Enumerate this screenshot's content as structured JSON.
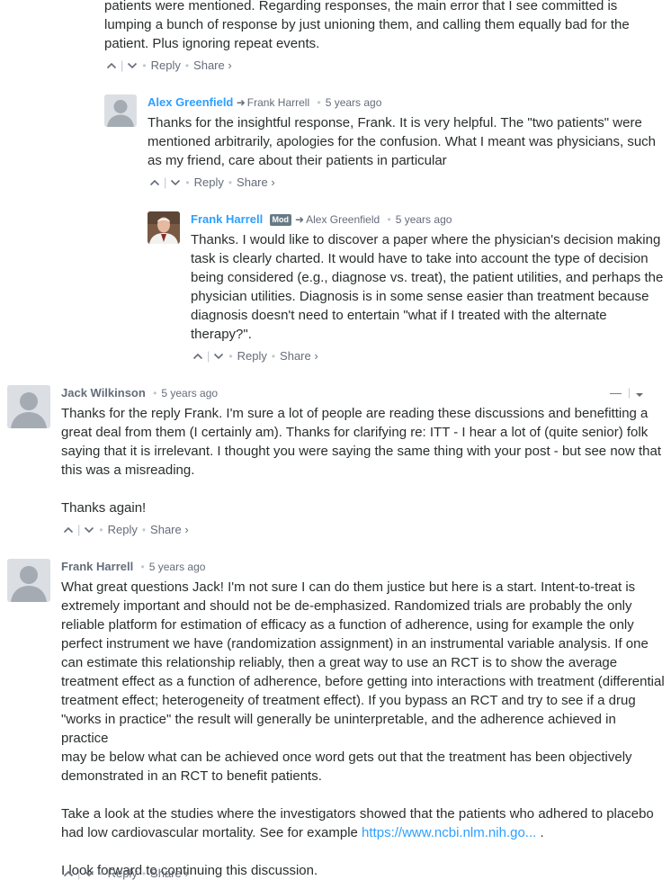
{
  "labels": {
    "reply": "Reply",
    "share": "Share ›",
    "mod_badge": "Mod"
  },
  "comment0": {
    "body_lines": [
      "patients were mentioned. Regarding responses, the main error that I see committed is",
      "lumping a bunch of response by just unioning them, and calling them equally bad for the",
      "patient. Plus ignoring repeat events."
    ]
  },
  "comment1": {
    "author": "Alex Greenfield",
    "in_reply_to": "Frank Harrell",
    "time": "5 years ago",
    "body_lines": [
      "Thanks for the insightful response, Frank. It is very helpful. The \"two patients\" were",
      "mentioned arbitrarily, apologies for the confusion. What I meant was physicians, such",
      "as my friend, care about their patients in particular"
    ]
  },
  "comment2": {
    "author": "Frank Harrell",
    "in_reply_to": "Alex Greenfield",
    "time": "5 years ago",
    "body_lines": [
      "Thanks. I would like to discover a paper where the physician's decision making",
      "task is clearly charted. It would have to take into account the type of decision",
      "being considered (e.g., diagnose vs. treat), the patient utilities, and perhaps the",
      "physician utilities. Diagnosis is in some sense easier than treatment because",
      "diagnosis doesn't need to entertain \"what if I treated with the alternate",
      "therapy?\"."
    ]
  },
  "comment3": {
    "author": "Jack Wilkinson",
    "time": "5 years ago",
    "body_lines": [
      "Thanks for the reply Frank. I'm sure a lot of people are reading these discussions and benefitting a",
      "great deal from them (I certainly am). Thanks for clarifying re: ITT - I hear a lot of (quite senior) folk",
      "saying that it is irrelevant. I thought you were saying the same thing with your post - but see now that",
      "this was a misreading."
    ],
    "closing": "Thanks again!"
  },
  "comment4": {
    "author": "Frank Harrell",
    "time": "5 years ago",
    "body_lines": [
      "What great questions Jack! I'm not sure I can do them justice but here is a start. Intent-to-treat is",
      "extremely important and should not be de-emphasized. Randomized trials are probably the only",
      "reliable platform for estimation of efficacy as a function of adherence, using for example the only",
      "perfect instrument we have (randomization assignment) in an instrumental variable analysis. If one",
      "can estimate this relationship reliably, then a great way to use an RCT is to show the average",
      "treatment effect as a function of adherence, before getting into interactions with treatment (differential",
      "treatment effect; heterogeneity of treatment effect). If you bypass an RCT and try to see if a drug",
      "\"works in practice\" the result will generally be uninterpretable, and the adherence achieved in practice",
      "may be below what can be achieved once word gets out that the treatment has been objectively",
      "demonstrated in an RCT to benefit patients."
    ],
    "para2_line1": "Take a look at the studies where the investigators showed that the patients who adhered to placebo",
    "para2_line2_prefix": "had low cardiovascular mortality. See for example ",
    "link_text": "https://www.ncbi.nlm.nih.go...",
    "para2_line2_suffix": " .",
    "closing": "I look forward to continuing this discussion."
  },
  "colors": {
    "link": "#2e9fff",
    "meta": "#656c7a",
    "text": "#2a2e2e",
    "mod_badge": "#687a86"
  }
}
